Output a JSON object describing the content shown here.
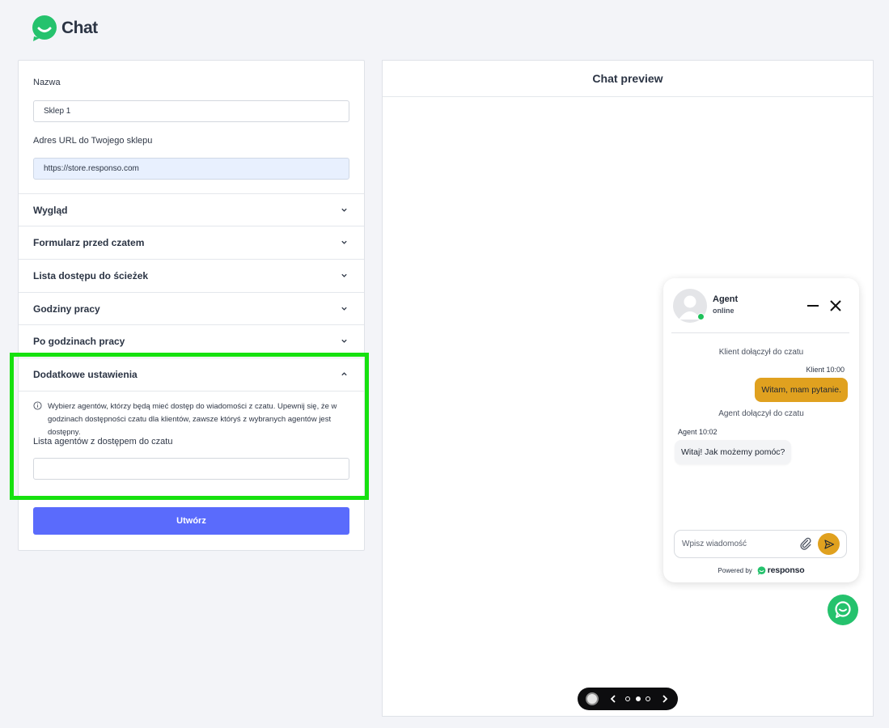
{
  "logo": {
    "text": "Chat"
  },
  "form": {
    "name_label": "Nazwa",
    "name_value": "Sklep 1",
    "url_label": "Adres URL do Twojego sklepu",
    "url_value": "https://store.responso.com",
    "sections": [
      {
        "title": "Wygląd",
        "expanded": false
      },
      {
        "title": "Formularz przed czatem",
        "expanded": false
      },
      {
        "title": "Lista dostępu do ścieżek",
        "expanded": false
      },
      {
        "title": "Godziny pracy",
        "expanded": false
      },
      {
        "title": "Po godzinach pracy",
        "expanded": false
      },
      {
        "title": "Dodatkowe ustawienia",
        "expanded": true
      }
    ],
    "additional": {
      "info_text": "Wybierz agentów, którzy będą mieć dostęp do wiadomości z czatu. Upewnij się, że w godzinach dostępności czatu dla klientów, zawsze któryś z wybranych agentów jest dostępny.",
      "agents_label": "Lista agentów z dostępem do czatu",
      "agents_value": ""
    },
    "create_button": "Utwórz"
  },
  "preview": {
    "title": "Chat preview",
    "widget": {
      "agent_name": "Agent",
      "agent_status": "online",
      "messages": [
        {
          "type": "system",
          "text": "Klient dołączył do czatu"
        },
        {
          "type": "client",
          "meta": "Klient 10:00",
          "text": "Witam, mam pytanie."
        },
        {
          "type": "system",
          "text": "Agent dołączył do czatu"
        },
        {
          "type": "agent",
          "meta": "Agent 10:02",
          "text": "Witaj! Jak możemy pomóc?"
        }
      ],
      "input_placeholder": "Wpisz wiadomość",
      "powered_by": "Powered by",
      "brand": "responso",
      "accent_color": "#e0a11f"
    },
    "pager": {
      "pages": 3,
      "active_page": 2
    }
  },
  "colors": {
    "primary": "#5a6bfc",
    "highlight": "#16e10f",
    "brand_green": "#25c26d"
  }
}
